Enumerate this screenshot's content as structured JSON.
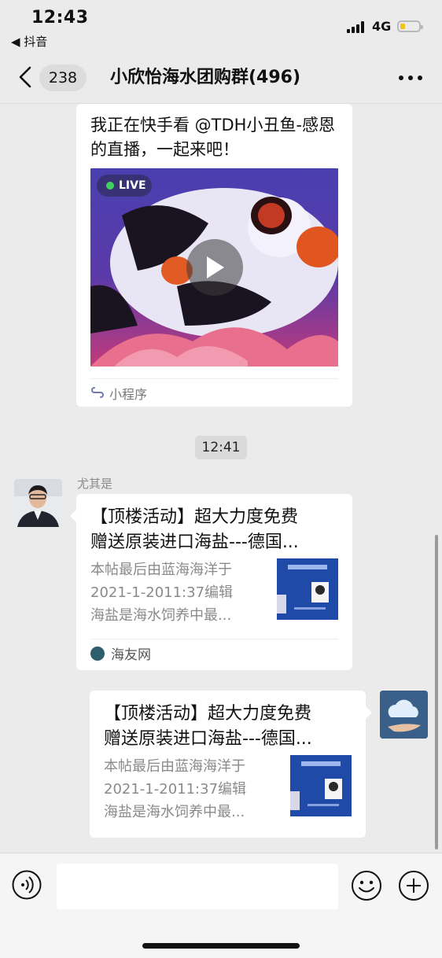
{
  "status_bar": {
    "time": "12:43",
    "back_app": "◀ 抖音",
    "network": "4G",
    "battery_level": 0.25
  },
  "nav": {
    "unread_count": "238",
    "title": "小欣怡海水团购群(496)"
  },
  "messages": {
    "live_share": {
      "text": "我正在快手看 @TDH小丑鱼-感恩的直播，一起来吧！",
      "badge": "LIVE",
      "source": "小程序"
    },
    "timestamp": "12:41",
    "link_left": {
      "sender": "尤其是",
      "title_line1": "【顶楼活动】超大力度免费",
      "title_line2": "赠送原装进口海盐---德国...",
      "desc_line1": "本帖最后由蓝海海洋于",
      "desc_line2": "2021-1-2011:37编辑",
      "desc_line3": "海盐是海水饲养中最...",
      "source": "海友网"
    },
    "link_right": {
      "title_line1": "【顶楼活动】超大力度免费",
      "title_line2": "赠送原装进口海盐---德国...",
      "desc_line1": "本帖最后由蓝海海洋于",
      "desc_line2": "2021-1-2011:37编辑",
      "desc_line3": "海盐是海水饲养中最..."
    }
  },
  "input": {
    "placeholder": ""
  },
  "colors": {
    "background": "#ebebeb",
    "card": "#ffffff",
    "live_dot": "#3ed35a",
    "battery": "#f0c418"
  },
  "icons": {
    "back": "chevron-left-icon",
    "more": "more-dots-icon",
    "voice": "voice-icon",
    "emoji": "emoji-icon",
    "plus": "plus-icon",
    "play": "play-icon",
    "mini_program": "mini-program-icon"
  }
}
